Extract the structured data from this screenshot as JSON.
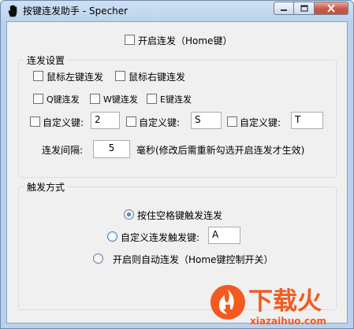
{
  "window": {
    "title": "按键连发助手 - Specher",
    "controls": {
      "minimize": "minimize",
      "maximize": "maximize",
      "close": "close"
    }
  },
  "master_toggle": {
    "label": "开启连发（Home键）",
    "checked": false
  },
  "burst_settings": {
    "title": "连发设置",
    "mouse_left": {
      "label": "鼠标左键连发",
      "checked": false
    },
    "mouse_right": {
      "label": "鼠标右键连发",
      "checked": false
    },
    "key_q": {
      "label": "Q键连发",
      "checked": false
    },
    "key_w": {
      "label": "W键连发",
      "checked": false
    },
    "key_e": {
      "label": "E键连发",
      "checked": false
    },
    "custom_keys": [
      {
        "label": "自定义键:",
        "value": "2",
        "checked": false
      },
      {
        "label": "自定义键:",
        "value": "S",
        "checked": false
      },
      {
        "label": "自定义键:",
        "value": "T",
        "checked": false
      }
    ],
    "interval": {
      "label": "连发间隔:",
      "value": "5",
      "unit_note": "毫秒(修改后需重新勾选开启连发才生效)"
    }
  },
  "trigger_mode": {
    "title": "触发方式",
    "options": [
      {
        "label": "按住空格键触发连发",
        "selected": true
      },
      {
        "label": "自定义连发触发键:",
        "selected": false,
        "key_value": "A"
      },
      {
        "label": "开启则自动连发（Home键控制开关）",
        "selected": false
      }
    ]
  },
  "watermark": {
    "brand": "下载火",
    "url": "xiazaihuo.com"
  },
  "colors": {
    "accent": "#3c7fb1",
    "watermark_orange": "#f25a1f",
    "close_button": "#c9523c"
  }
}
